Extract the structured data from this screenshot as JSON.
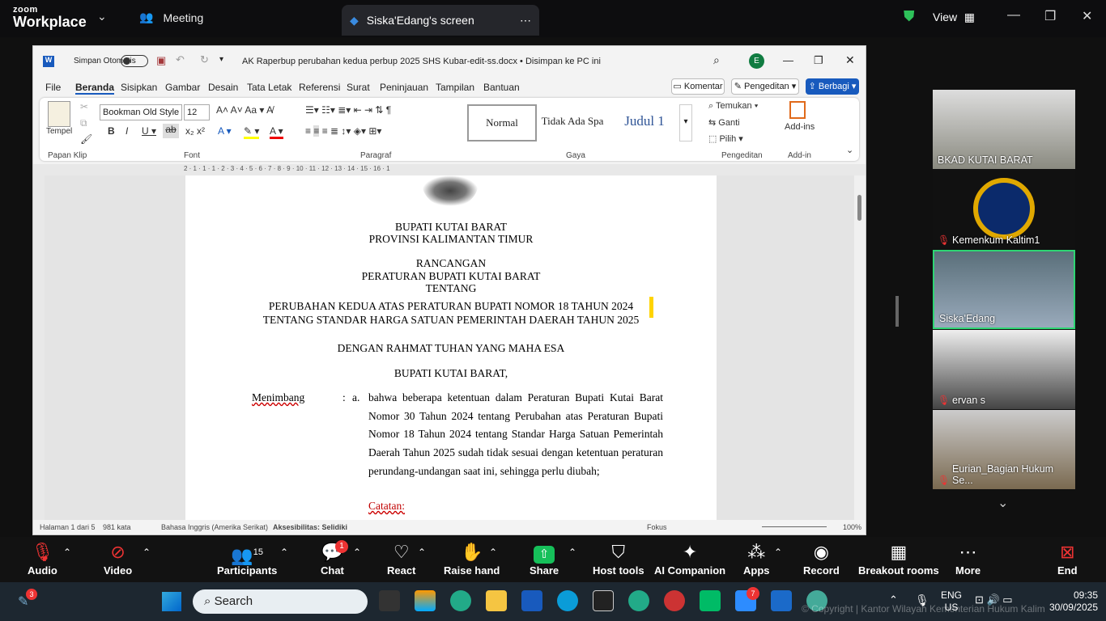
{
  "zoom": {
    "logo_small": "zoom",
    "logo_large": "Workplace",
    "meeting_label": "Meeting",
    "share_tab": "Siska'Edang's screen",
    "view_label": "View"
  },
  "word": {
    "autosave_label": "Simpan Otomatis",
    "doc_title": "AK Raperbup perubahan kedua perbup 2025 SHS Kubar-edit-ss.docx • Disimpan ke PC ini",
    "avatar": "E",
    "tabs": [
      "File",
      "Beranda",
      "Sisipkan",
      "Gambar",
      "Desain",
      "Tata Letak",
      "Referensi",
      "Surat",
      "Peninjauan",
      "Tampilan",
      "Bantuan"
    ],
    "comment_btn": "Komentar",
    "editing_btn": "Pengeditan",
    "share_btn": "Berbagi",
    "clipboard_label": "Tempel",
    "group_clipboard": "Papan Klip",
    "font_name": "Bookman Old Style",
    "font_size": "12",
    "group_font": "Font",
    "group_paragraph": "Paragraf",
    "styles": [
      "Normal",
      "Tidak Ada Spa",
      "Judul 1"
    ],
    "group_styles": "Gaya",
    "find": "Temukan",
    "replace": "Ganti",
    "select": "Pilih",
    "group_editing": "Pengeditan",
    "addins": "Add-ins",
    "group_addins": "Add-in",
    "ruler_marks": "2 · 1 · 1 · 1 · 2 · 3 · 4 · 5 · 6 · 7 · 8 · 9 · 10 · 11 · 12 · 13 · 14 · 15 · 16 · 1"
  },
  "doc": {
    "l1": "BUPATI KUTAI BARAT",
    "l2": "PROVINSI KALIMANTAN TIMUR",
    "l3": "RANCANGAN",
    "l4": "PERATURAN BUPATI KUTAI BARAT",
    "l5": "TENTANG",
    "l6": "PERUBAHAN KEDUA ATAS PERATURAN BUPATI NOMOR 18 TAHUN 2024",
    "l7": "TENTANG STANDAR HARGA SATUAN PEMERINTAH DAERAH TAHUN 2025",
    "l8": "DENGAN RAHMAT TUHAN YANG MAHA ESA",
    "l9": "BUPATI KUTAI BARAT,",
    "menimbang": "Menimbang",
    ":": ":",
    "a": "a.",
    "para": "bahwa beberapa ketentuan dalam Peraturan Bupati Kutai Barat Nomor 30 Tahun 2024 tentang Perubahan atas Peraturan Bupati Nomor 18 Tahun 2024 tentang Standar Harga Satuan Pemerintah Daerah Tahun 2025 sudah tidak sesuai dengan ketentuan peraturan perundang-undangan saat ini, sehingga perlu diubah;",
    "catatan": "Catatan:"
  },
  "status": {
    "page": "Halaman 1 dari 5",
    "words": "981 kata",
    "lang": "Bahasa Inggris (Amerika Serikat)",
    "access": "Aksesibilitas: Selidiki",
    "focus": "Fokus",
    "zoom": "100%"
  },
  "participants": [
    {
      "name": "BKAD KUTAI BARAT"
    },
    {
      "name": "Kemenkum Kaltim1"
    },
    {
      "name": "Siska'Edang"
    },
    {
      "name": "ervan s"
    },
    {
      "name": "Eurian_Bagian Hukum Se..."
    }
  ],
  "toolbar": {
    "audio": "Audio",
    "video": "Video",
    "participants": "Participants",
    "participants_count": "15",
    "chat": "Chat",
    "chat_badge": "1",
    "react": "React",
    "raise": "Raise hand",
    "share": "Share",
    "host": "Host tools",
    "ai": "AI Companion",
    "apps": "Apps",
    "record": "Record",
    "breakout": "Breakout rooms",
    "more": "More",
    "end": "End"
  },
  "taskbar": {
    "search": "Search",
    "badge": "3",
    "lang1": "ENG",
    "lang2": "US",
    "time": "09:35",
    "date": "30/09/2025",
    "zoom_badge": "7",
    "watermark": "© Copyright | Kantor Wilayah Kementerian Hukum Kalimantan"
  }
}
